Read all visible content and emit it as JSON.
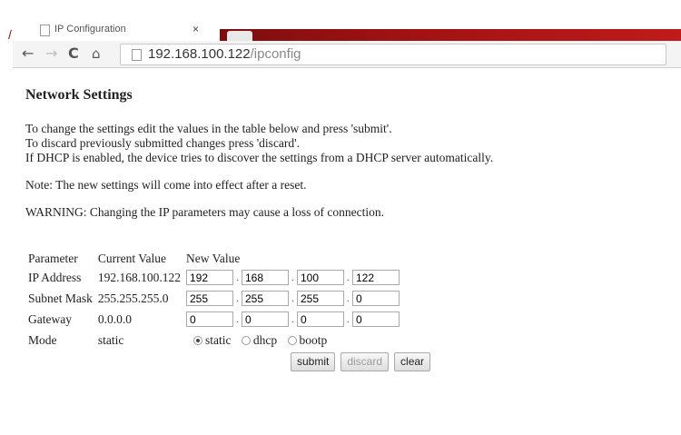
{
  "browser": {
    "tab_title": "IP Configuration",
    "tab_close": "×",
    "url_host": "192.168.100.122",
    "url_path": "/ipconfig",
    "accent_color": "#a01212"
  },
  "page": {
    "heading": "Network Settings",
    "intro_lines": [
      "To change the settings edit the values in the table below and press 'submit'.",
      "To discard previously submitted changes press 'discard'.",
      "If DHCP is enabled, the device tries to discover the settings from a DHCP server automatically."
    ],
    "note": "Note: The new settings will come into effect after a reset.",
    "warning": "WARNING: Changing the IP parameters may cause a loss of connection.",
    "table": {
      "headers": [
        "Parameter",
        "Current Value",
        "New Value"
      ],
      "rows": [
        {
          "param": "IP Address",
          "current": "192.168.100.122",
          "octets": [
            "192",
            "168",
            "100",
            "122"
          ]
        },
        {
          "param": "Subnet Mask",
          "current": "255.255.255.0",
          "octets": [
            "255",
            "255",
            "255",
            "0"
          ]
        },
        {
          "param": "Gateway",
          "current": "0.0.0.0",
          "octets": [
            "0",
            "0",
            "0",
            "0"
          ]
        }
      ],
      "mode": {
        "param": "Mode",
        "current": "static",
        "options": [
          "static",
          "dhcp",
          "bootp"
        ],
        "selected": "static"
      },
      "dot": "."
    },
    "buttons": {
      "submit": "submit",
      "discard": "discard",
      "clear": "clear"
    }
  }
}
